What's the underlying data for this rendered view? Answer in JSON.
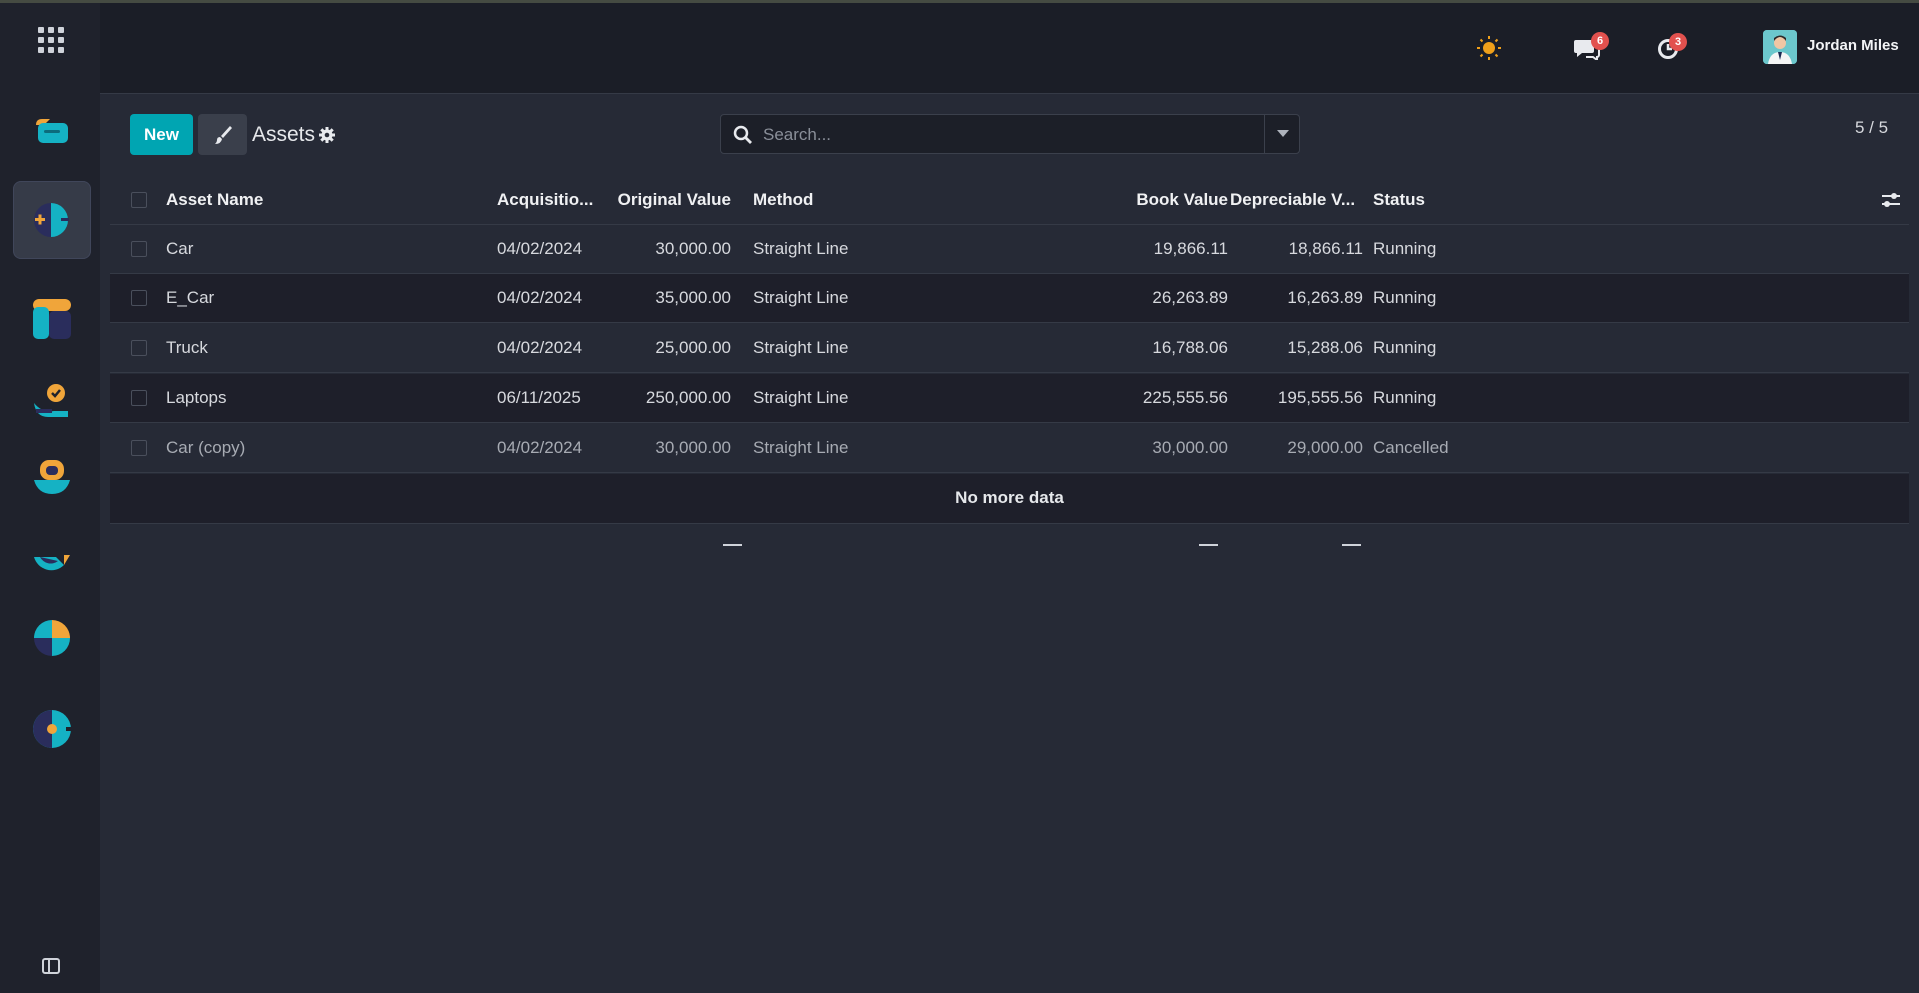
{
  "navbar": {
    "user_name": "Jordan Miles",
    "messages_count": "6",
    "activities_count": "3",
    "theme_icon": "sun-icon"
  },
  "sidebar": {
    "apps": [
      "discuss-app-icon",
      "assets-app-icon",
      "dashboard-app-icon",
      "approvals-app-icon",
      "contacts-app-icon",
      "crm-app-icon",
      "reports-app-icon",
      "settings-app-icon"
    ]
  },
  "control": {
    "new_label": "New",
    "breadcrumb": "Assets",
    "search_placeholder": "Search...",
    "pager": "5 / 5"
  },
  "table": {
    "headers": [
      "Asset Name",
      "Acquisitio...",
      "Original Value",
      "Method",
      "Book Value",
      "Depreciable V...",
      "Status"
    ],
    "rows": [
      {
        "name": "Car",
        "date": "04/02/2024",
        "original": "30,000.00",
        "method": "Straight Line",
        "book": "19,866.11",
        "depreciable": "18,866.11",
        "status": "Running"
      },
      {
        "name": "E_Car",
        "date": "04/02/2024",
        "original": "35,000.00",
        "method": "Straight Line",
        "book": "26,263.89",
        "depreciable": "16,263.89",
        "status": "Running"
      },
      {
        "name": "Truck",
        "date": "04/02/2024",
        "original": "25,000.00",
        "method": "Straight Line",
        "book": "16,788.06",
        "depreciable": "15,288.06",
        "status": "Running"
      },
      {
        "name": "Laptops",
        "date": "06/11/2025",
        "original": "250,000.00",
        "method": "Straight Line",
        "book": "225,555.56",
        "depreciable": "195,555.56",
        "status": "Running"
      },
      {
        "name": "Car (copy)",
        "date": "04/02/2024",
        "original": "30,000.00",
        "method": "Straight Line",
        "book": "30,000.00",
        "depreciable": "29,000.00",
        "status": "Cancelled"
      }
    ],
    "no_more": "No more data",
    "totals": [
      "—",
      "—",
      "—"
    ]
  },
  "colors": {
    "accent": "#00a5b2",
    "badge": "#e2514e",
    "background": "#262a36"
  }
}
